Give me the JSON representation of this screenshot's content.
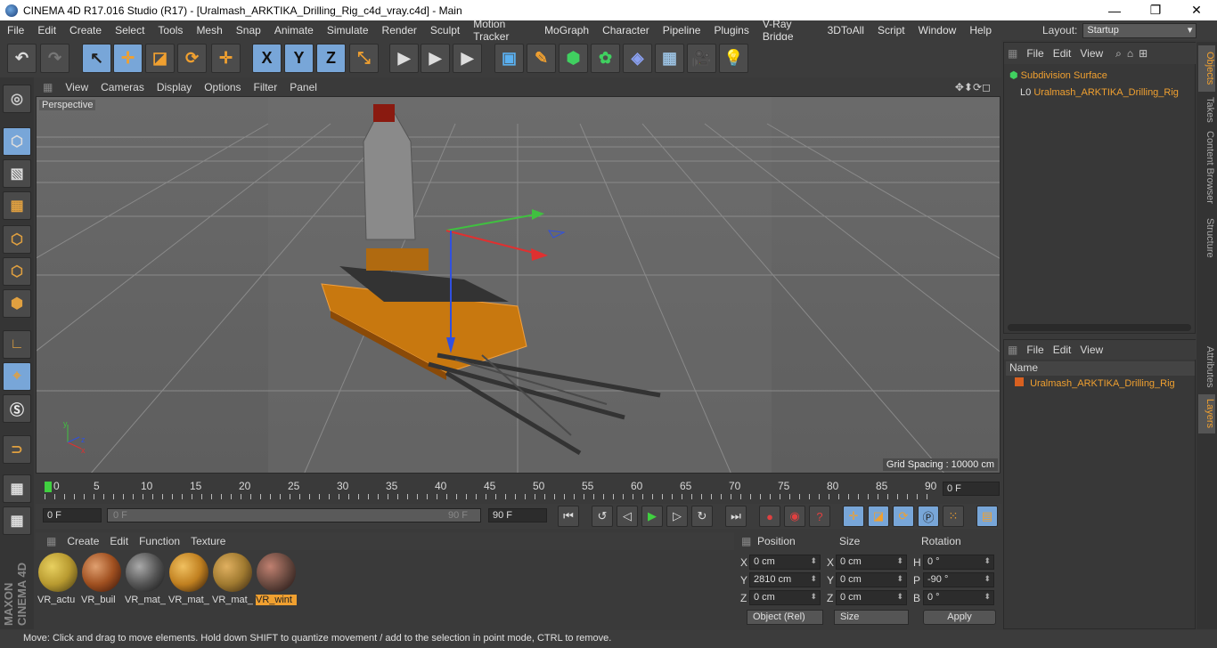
{
  "window": {
    "title": "CINEMA 4D R17.016 Studio (R17) - [Uralmash_ARKTIKA_Drilling_Rig_c4d_vray.c4d] - Main",
    "minimize": "—",
    "maximize": "❐",
    "close": "✕"
  },
  "menu": [
    "File",
    "Edit",
    "Create",
    "Select",
    "Tools",
    "Mesh",
    "Snap",
    "Animate",
    "Simulate",
    "Render",
    "Sculpt",
    "Motion Tracker",
    "MoGraph",
    "Character",
    "Pipeline",
    "Plugins",
    "V-Ray Bridge",
    "3DToAll",
    "Script",
    "Window",
    "Help"
  ],
  "layout": {
    "label": "Layout:",
    "value": "Startup"
  },
  "toolbar": {
    "undo": "↶",
    "redo": "↷",
    "select": "↖",
    "move": "✛",
    "scale": "◪",
    "rotate": "⟳",
    "live": "✛",
    "x": "X",
    "y": "Y",
    "z": "Z",
    "coord": "⤡",
    "render_view": "▶",
    "render_pv": "▶",
    "render_settings": "▶",
    "cube": "▣",
    "pen": "✎",
    "subdiv": "⬢",
    "cloner": "✿",
    "deformer": "◈",
    "floor": "▦",
    "camera": "🎥",
    "light": "💡"
  },
  "viewport": {
    "menu": [
      "View",
      "Cameras",
      "Display",
      "Options",
      "Filter",
      "Panel"
    ],
    "label": "Perspective",
    "grid_spacing": "Grid Spacing : 10000 cm",
    "nav": "✥⬍⟳◻"
  },
  "timeline": {
    "ticks": [
      "0",
      "5",
      "10",
      "15",
      "20",
      "25",
      "30",
      "35",
      "40",
      "45",
      "50",
      "55",
      "60",
      "65",
      "70",
      "75",
      "80",
      "85",
      "90"
    ],
    "current": "0 F"
  },
  "transport": {
    "start": "0 F",
    "range_start": "0 F",
    "range_end": "90 F",
    "end": "90 F"
  },
  "materials": {
    "menu": [
      "Create",
      "Edit",
      "Function",
      "Texture"
    ],
    "items": [
      {
        "label": "VR_actu",
        "color": "#b89a30"
      },
      {
        "label": "VR_buil",
        "color": "#a05020"
      },
      {
        "label": "VR_mat_",
        "color": "#555555"
      },
      {
        "label": "VR_mat_",
        "color": "#c08020"
      },
      {
        "label": "VR_mat_",
        "color": "#a07a30"
      },
      {
        "label": "VR_wint",
        "color": "#6a4a40"
      }
    ]
  },
  "coords": {
    "headers": [
      "Position",
      "Size",
      "Rotation"
    ],
    "rows": [
      {
        "axis": "X",
        "pos": "0 cm",
        "saxis": "X",
        "size": "0 cm",
        "raxis": "H",
        "rot": "0 °"
      },
      {
        "axis": "Y",
        "pos": "2810 cm",
        "saxis": "Y",
        "size": "0 cm",
        "raxis": "P",
        "rot": "-90 °"
      },
      {
        "axis": "Z",
        "pos": "0 cm",
        "saxis": "Z",
        "size": "0 cm",
        "raxis": "B",
        "rot": "0 °"
      }
    ],
    "mode": "Object (Rel)",
    "size_mode": "Size",
    "apply": "Apply"
  },
  "objects": {
    "menu": [
      "File",
      "Edit",
      "View"
    ],
    "items": [
      "Subdivision Surface",
      "Uralmash_ARKTIKA_Drilling_Rig"
    ]
  },
  "layers": {
    "menu": [
      "File",
      "Edit",
      "View"
    ],
    "header": "Name",
    "items": [
      "Uralmash_ARKTIKA_Drilling_Rig"
    ]
  },
  "sidetabs": [
    "Objects",
    "Takes",
    "Content Browser",
    "Structure",
    "Attributes",
    "Layers"
  ],
  "brand": "MAXON CINEMA 4D",
  "status": "Move: Click and drag to move elements. Hold down SHIFT to quantize movement / add to the selection in point mode, CTRL to remove."
}
